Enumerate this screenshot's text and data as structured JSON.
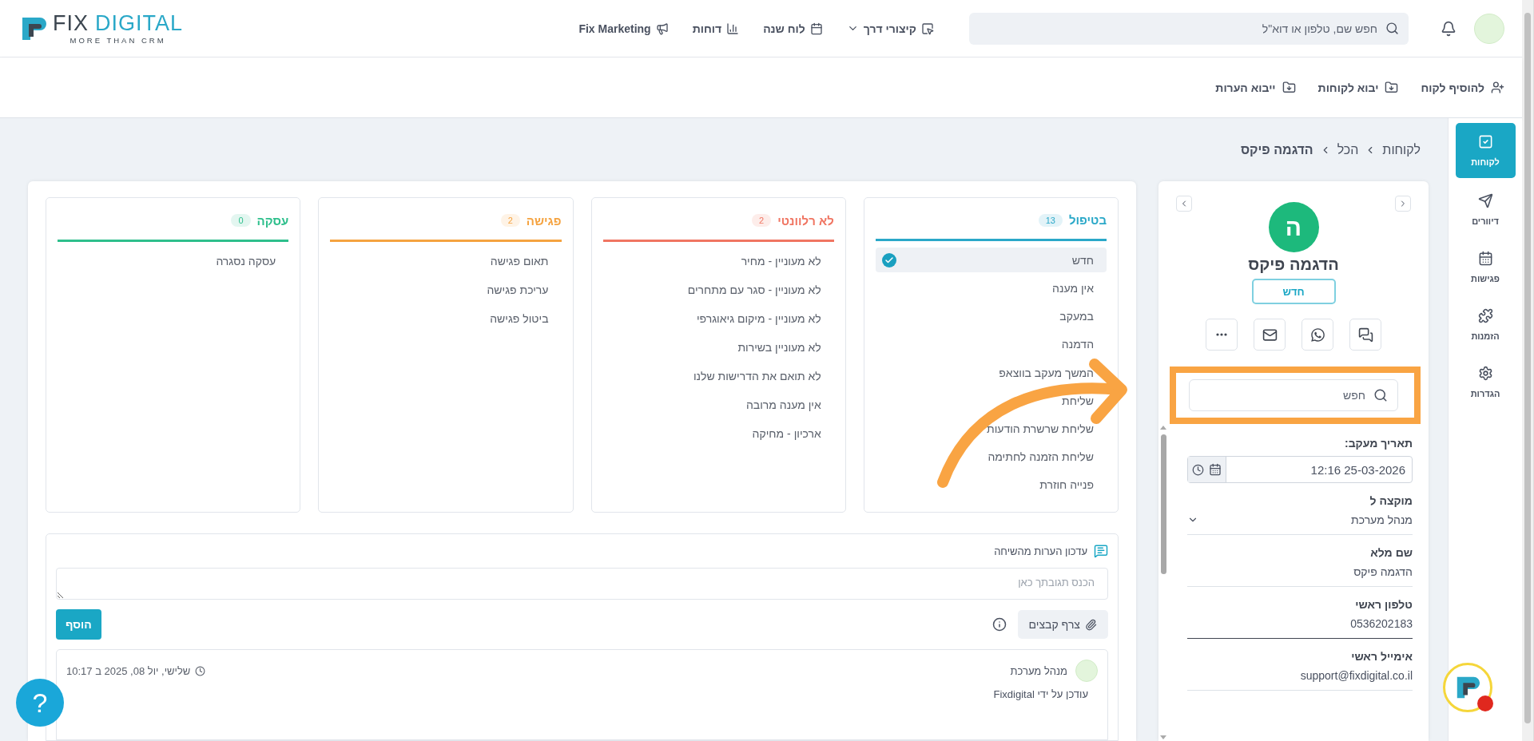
{
  "header": {
    "logo": {
      "word_1": "FIX",
      "word_2": "DIGITAL",
      "tagline": "MORE THAN CRM"
    },
    "nav": [
      {
        "kind": "menu",
        "label": "קיצורי דרך"
      },
      {
        "kind": "link",
        "label": "לוח שנה"
      },
      {
        "kind": "link",
        "label": "דוחות"
      },
      {
        "kind": "link",
        "label": "Fix Marketing"
      }
    ],
    "search": {
      "placeholder": "חפש שם, טלפון או דוא\"ל"
    }
  },
  "toolbar": [
    "להוסיף לקוח",
    "יבוא לקוחות",
    "ייבוא הערות"
  ],
  "breadcrumb": [
    "לקוחות",
    "הכל",
    "הדגמה פיקס"
  ],
  "stages": [
    {
      "title": "בטיפול",
      "count": "13",
      "color": "#2aa8c8",
      "items": [
        {
          "label": "חדש",
          "selected": true
        },
        {
          "label": "אין מענה",
          "selected": false
        },
        {
          "label": "במעקב",
          "selected": false
        },
        {
          "label": "הדמנה",
          "selected": false
        },
        {
          "label": "המשך מעקב בווצאפ",
          "selected": false
        },
        {
          "label": "שליחת",
          "selected": false
        },
        {
          "label": "שליחת שרשרת הודעות",
          "selected": false
        },
        {
          "label": "שליחת הזמנה לחתימה",
          "selected": false
        },
        {
          "label": "פנייה חוזרת",
          "selected": false
        }
      ]
    },
    {
      "title": "לא רלוונטי",
      "count": "2",
      "color": "#f07562",
      "items": [
        {
          "label": "לא מעוניין - מחיר",
          "selected": false
        },
        {
          "label": "לא מעוניין - סגר עם מתחרים",
          "selected": false
        },
        {
          "label": "לא מעוניין - מיקום גיאוגרפי",
          "selected": false
        },
        {
          "label": "לא מעוניין בשירות",
          "selected": false
        },
        {
          "label": "לא תואם את הדרישות שלנו",
          "selected": false
        },
        {
          "label": "אין מענה מרובה",
          "selected": false
        },
        {
          "label": "ארכיון - מחיקה",
          "selected": false
        }
      ]
    },
    {
      "title": "פגישה",
      "count": "2",
      "color": "#f5a340",
      "items": [
        {
          "label": "תאום פגישה",
          "selected": false
        },
        {
          "label": "עריכת פגישה",
          "selected": false
        },
        {
          "label": "ביטול פגישה",
          "selected": false
        }
      ]
    },
    {
      "title": "עסקה",
      "count": "0",
      "color": "#2ebf8c",
      "items": [
        {
          "label": "עסקה נסגרה",
          "selected": false
        }
      ]
    }
  ],
  "notes": {
    "title": "עדכון הערות מהשיחה",
    "placeholder": "הכנס תגובתך כאן",
    "attach": "צרף קבצים",
    "add": "הוסף",
    "entries": [
      {
        "author": "מנהל מערכת",
        "time": "שלישי, יול 08, 2025 ב 10:17",
        "text": "עודכן על ידי Fixdigital"
      }
    ]
  },
  "contact": {
    "avatar_letter": "ה",
    "name": "הדגמה פיקס",
    "status": "חדש",
    "search_placeholder": "חפש",
    "fields": [
      {
        "kind": "datetime",
        "label": "תאריך מעקב:",
        "value": "12:16 25-03-2026",
        "hovered": false
      },
      {
        "kind": "select",
        "label": "מוקצה ל",
        "value": "מנהל מערכת",
        "hovered": false
      },
      {
        "kind": "text",
        "label": "שם מלא",
        "value": "הדגמה פיקס",
        "hovered": false
      },
      {
        "kind": "text",
        "label": "טלפון ראשי",
        "value": "0536202183",
        "hovered": true
      },
      {
        "kind": "text",
        "label": "אימייל ראשי",
        "value": "support@fixdigital.co.il",
        "hovered": false
      }
    ]
  },
  "sidebar": [
    {
      "label": "לקוחות",
      "selected": true
    },
    {
      "label": "דיוורים",
      "selected": false
    },
    {
      "label": "פגישות",
      "selected": false
    },
    {
      "label": "הזמנות",
      "selected": false
    },
    {
      "label": "הגדרות",
      "selected": false
    }
  ],
  "help": "?"
}
